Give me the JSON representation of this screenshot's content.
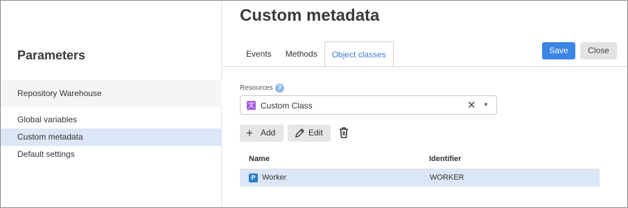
{
  "sidebar": {
    "title": "Parameters",
    "group": "Repository Warehouse",
    "items": [
      {
        "label": "Global variables"
      },
      {
        "label": "Custom metadata"
      },
      {
        "label": "Default settings"
      }
    ],
    "active_index": 1
  },
  "page": {
    "title": "Custom metadata"
  },
  "tabs": [
    {
      "label": "Events"
    },
    {
      "label": "Methods"
    },
    {
      "label": "Object classes"
    }
  ],
  "active_tab": 2,
  "actions": {
    "save_label": "Save",
    "close_label": "Close"
  },
  "resources": {
    "label": "Resources",
    "help_glyph": "?",
    "value": "Custom Class",
    "icon": "custom-class-icon",
    "clear_glyph": "✕",
    "caret_glyph": "▼"
  },
  "toolbar": {
    "add_label": "Add",
    "add_glyph": "+",
    "edit_label": "Edit",
    "delete_icon": "trash-icon"
  },
  "table": {
    "columns": [
      "Name",
      "Identifier"
    ],
    "rows": [
      {
        "name": "Worker",
        "identifier": "WORKER",
        "icon": "class-icon",
        "selected": true
      }
    ]
  },
  "colors": {
    "accent": "#3b86e4",
    "selection": "#dbe6f6",
    "tab_active_text": "#3c7dd6"
  }
}
